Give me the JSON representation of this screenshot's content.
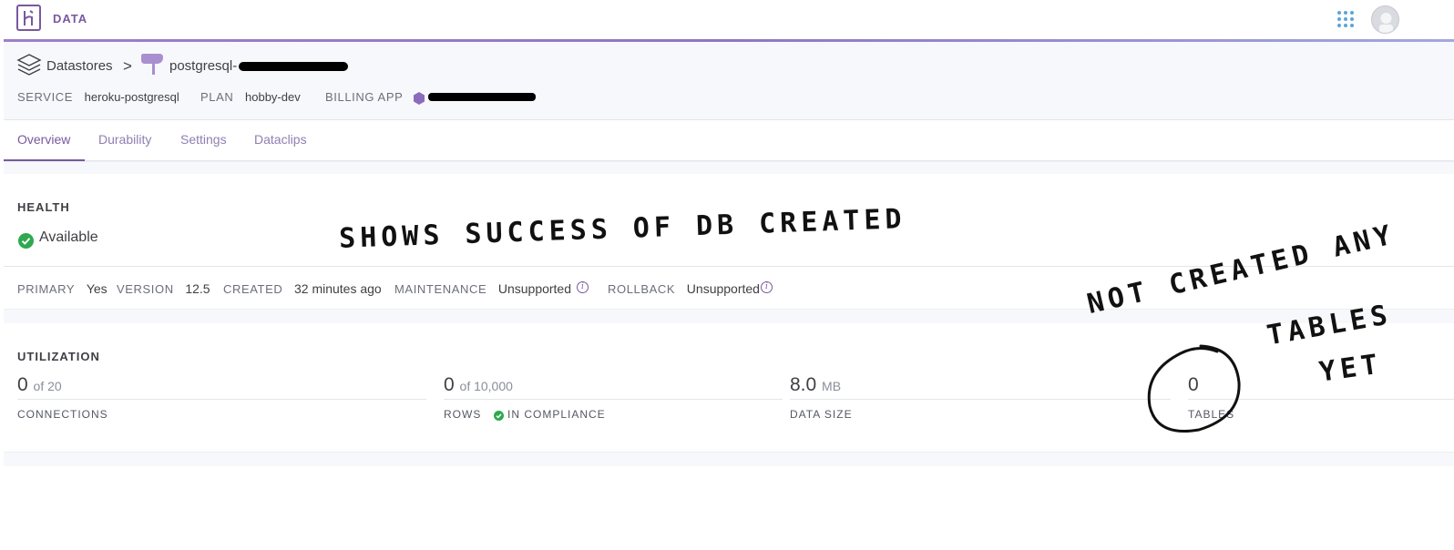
{
  "app": {
    "brand": "DATA",
    "logo_icon": "heroku-logo-icon",
    "apps_icon": "apps-grid-icon",
    "avatar_icon": "user-avatar-icon",
    "accent_color": "#79589f"
  },
  "breadcrumb": {
    "root": "Datastores",
    "separator": ">",
    "database": "postgresql-"
  },
  "meta": {
    "service_label": "SERVICE",
    "service_value": "heroku-postgresql",
    "plan_label": "PLAN",
    "plan_value": "hobby-dev",
    "billing_label": "BILLING APP"
  },
  "tabs": [
    {
      "label": "Overview",
      "active": true
    },
    {
      "label": "Durability",
      "active": false
    },
    {
      "label": "Settings",
      "active": false
    },
    {
      "label": "Dataclips",
      "active": false
    }
  ],
  "health": {
    "title": "HEALTH",
    "status": "Available",
    "status_color": "#2fa84f"
  },
  "stats": {
    "primary_label": "PRIMARY",
    "primary_value": "Yes",
    "version_label": "VERSION",
    "version_value": "12.5",
    "created_label": "CREATED",
    "created_value": "32 minutes ago",
    "maintenance_label": "MAINTENANCE",
    "maintenance_value": "Unsupported",
    "rollback_label": "ROLLBACK",
    "rollback_value": "Unsupported",
    "info_glyph": "i"
  },
  "utilization": {
    "title": "UTILIZATION",
    "connections": {
      "value": "0",
      "of": "of 20",
      "label": "CONNECTIONS"
    },
    "rows": {
      "value": "0",
      "of": "of 10,000",
      "label": "ROWS",
      "compliance": "IN COMPLIANCE"
    },
    "data_size": {
      "value": "8.0",
      "unit": "MB",
      "label": "DATA SIZE"
    },
    "tables": {
      "value": "0",
      "label": "TABLES"
    }
  },
  "annotations": {
    "success_note": "SHOWS SUCCESS OF DB CREATED",
    "tables_note_line1": "NOT CREATED ANY",
    "tables_note_line2": "TABLES",
    "tables_note_line3": "YET"
  }
}
